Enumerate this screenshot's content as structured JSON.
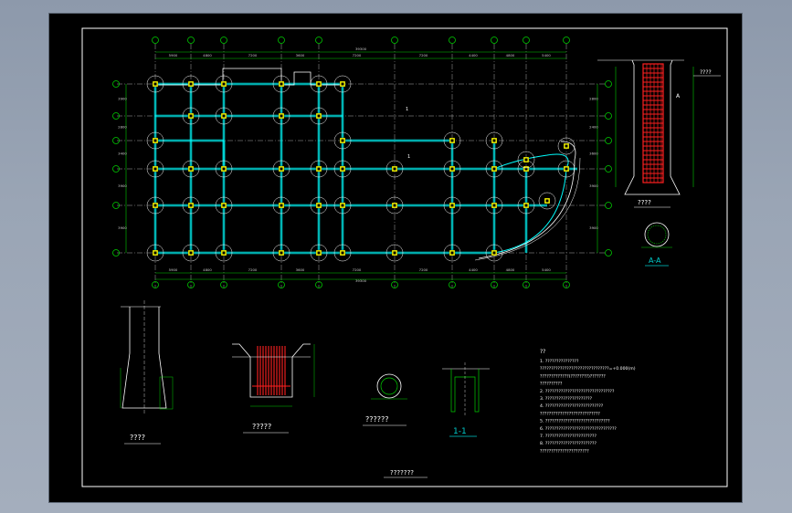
{
  "drawing": {
    "title_block": "???????",
    "colors": {
      "background": "#000000",
      "beam": "#00ffff",
      "axis": "#00cc00",
      "column": "#ffff00",
      "rebar": "#ff2020",
      "text": "#ffffff",
      "dim": "#00cc00",
      "outline": "#ffffff"
    },
    "top_dims": [
      "5900",
      "4800",
      "7200",
      "3600",
      "7200",
      "7200",
      "4400",
      "4800",
      "5400"
    ],
    "top_total": "39300",
    "bottom_dims": [
      "5900",
      "4800",
      "7200",
      "3600",
      "7200",
      "7200",
      "4400",
      "4800",
      "5400"
    ],
    "bottom_total": "39300",
    "left_dims": [
      "3900",
      "2800",
      "3400",
      "3900",
      "3900"
    ],
    "right_dims": [
      "2800",
      "2400",
      "3600",
      "3900",
      "3900"
    ],
    "section_labels": {
      "aa_title": "A-A",
      "aa_upper": "????",
      "aa_elev": "????",
      "col_detail": "????",
      "pile_cap": "?????",
      "pile_sect": "??????",
      "one_one": "1-1",
      "section_mark_A": "A",
      "section_mark_1": "1"
    },
    "notes_title": "??",
    "notes": [
      "1. ???????????????",
      "   ???????????????????????????????=+0.000(m)",
      "   ?????????????(????????)???????",
      "   ??????????",
      "2. ???????????????????????????????",
      "3. ?????????????????????",
      "4. ??????????????????????????",
      "   ???????????????????????????",
      "5. ?????????????????????????????",
      "6. ????????????????????????????????",
      "7. ???????????????????????",
      "8. ???????????????????????",
      "   ??????????????????????"
    ]
  }
}
